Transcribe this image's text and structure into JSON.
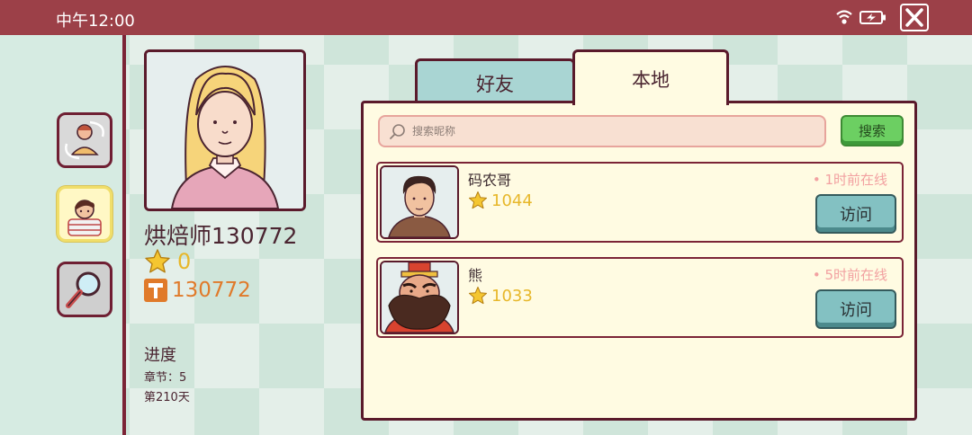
{
  "status_bar": {
    "time": "中午12:00",
    "icons": [
      "wifi-icon",
      "battery-charging-icon"
    ],
    "close_icon": "close-icon"
  },
  "rail": {
    "items": [
      "character-swap-icon",
      "profile-icon",
      "search-magnifier-icon"
    ],
    "active_index": 1
  },
  "profile": {
    "name": "烘焙师130772",
    "stars": "0",
    "coins": "130772",
    "progress_title": "进度",
    "chapter": "章节：5",
    "day": "第210天"
  },
  "tabs": [
    {
      "label": "好友",
      "selected": false
    },
    {
      "label": "本地",
      "selected": true
    }
  ],
  "search": {
    "placeholder": "搜索昵称",
    "button_label": "搜索"
  },
  "friends": [
    {
      "name": "码农哥",
      "score": "1044",
      "status": "1时前在线",
      "visit_label": "访问"
    },
    {
      "name": "熊",
      "score": "1033",
      "status": "5时前在线",
      "visit_label": "访问"
    }
  ],
  "colors": {
    "header": "#9c4048",
    "accent_border": "#5a1a2b",
    "panel_bg": "#fffbe2",
    "star": "#e7b72a",
    "coin": "#e07a2a",
    "online": "#f2a1a1",
    "visit_button": "#83c1c2",
    "search_button": "#6ccf62"
  }
}
